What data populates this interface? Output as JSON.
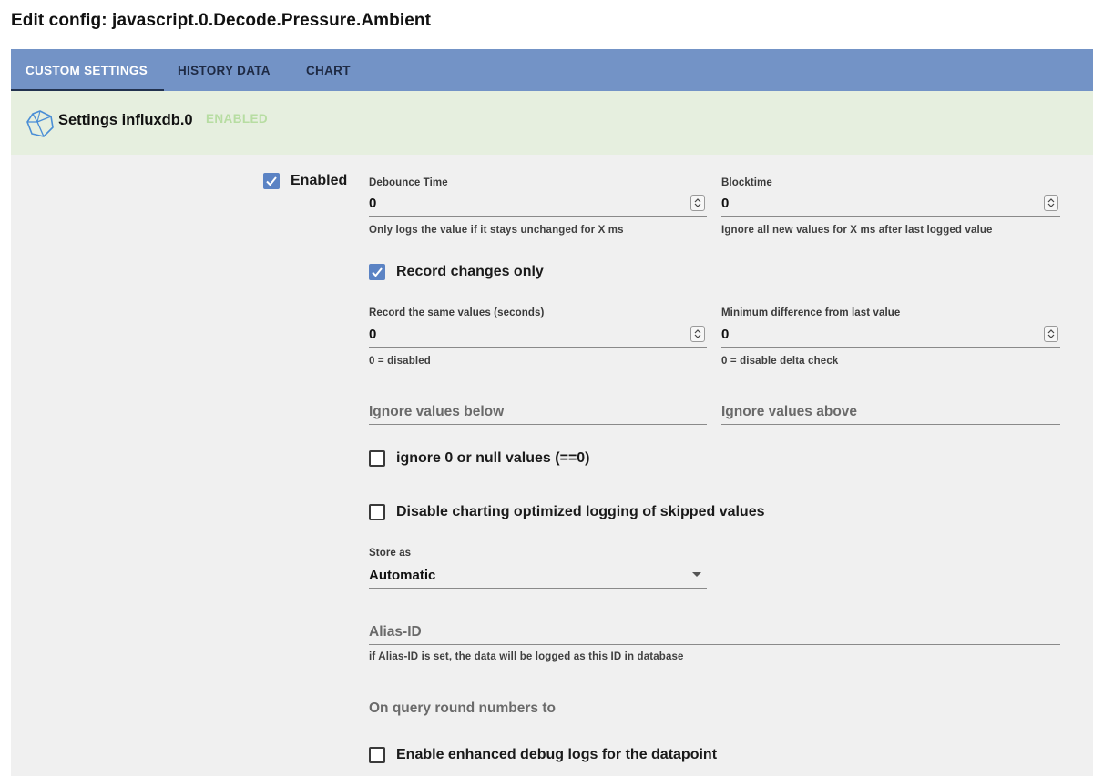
{
  "page": {
    "title": "Edit config: javascript.0.Decode.Pressure.Ambient"
  },
  "tabs": [
    {
      "label": "CUSTOM SETTINGS",
      "active": true
    },
    {
      "label": "HISTORY DATA",
      "active": false
    },
    {
      "label": "CHART",
      "active": false
    }
  ],
  "instance": {
    "title": "Settings influxdb.0",
    "status": "ENABLED",
    "icon": "influxdb-logo-icon"
  },
  "form": {
    "enabled": {
      "label": "Enabled",
      "checked": true
    },
    "debounce": {
      "label": "Debounce Time",
      "value": "0",
      "helper": "Only logs the value if it stays unchanged for X ms"
    },
    "blocktime": {
      "label": "Blocktime",
      "value": "0",
      "helper": "Ignore all new values for X ms after last logged value"
    },
    "record_changes_only": {
      "label": "Record changes only",
      "checked": true
    },
    "record_same_values": {
      "label": "Record the same values (seconds)",
      "value": "0",
      "helper": "0 = disabled"
    },
    "min_difference": {
      "label": "Minimum difference from last value",
      "value": "0",
      "helper": "0 = disable delta check"
    },
    "ignore_below": {
      "placeholder": "Ignore values below",
      "value": ""
    },
    "ignore_above": {
      "placeholder": "Ignore values above",
      "value": ""
    },
    "ignore_zero": {
      "label": "ignore 0 or null values (==0)",
      "checked": false
    },
    "disable_skipped": {
      "label": "Disable charting optimized logging of skipped values",
      "checked": false
    },
    "store_as": {
      "label": "Store as",
      "value": "Automatic"
    },
    "alias_id": {
      "placeholder": "Alias-ID",
      "value": "",
      "helper": "if Alias-ID is set, the data will be logged as this ID in database"
    },
    "round_numbers": {
      "placeholder": "On query round numbers to",
      "value": ""
    },
    "debug_logs": {
      "label": "Enable enhanced debug logs for the datapoint",
      "checked": false
    }
  },
  "colors": {
    "tab_bar": "#7393c6",
    "header_bg": "#e6efdf",
    "status_enabled": "#b7dda2",
    "checkbox_checked": "#5b83c4",
    "panel_bg": "#f0f0f0"
  }
}
